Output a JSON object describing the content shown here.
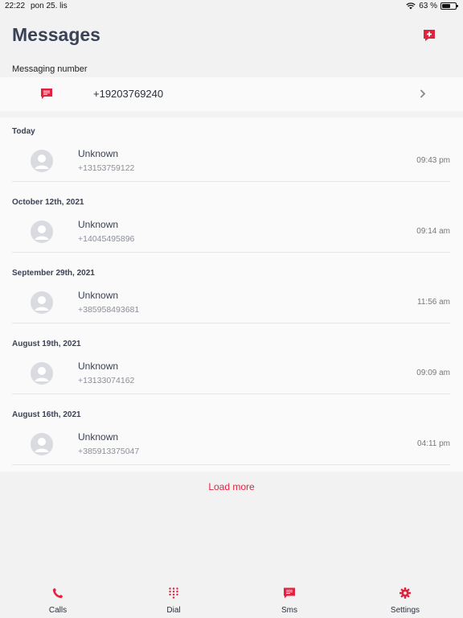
{
  "status_bar": {
    "time": "22:22",
    "date": "pon 25. lis",
    "battery": "63 %",
    "battery_level": 0.63
  },
  "header": {
    "title": "Messages"
  },
  "messaging_number": {
    "label": "Messaging number",
    "value": "+19203769240"
  },
  "groups": [
    {
      "date": "Today",
      "message": {
        "name": "Unknown",
        "number": "+13153759122",
        "time": "09:43 pm"
      }
    },
    {
      "date": "October 12th, 2021",
      "message": {
        "name": "Unknown",
        "number": "+14045495896",
        "time": "09:14 am"
      }
    },
    {
      "date": "September 29th, 2021",
      "message": {
        "name": "Unknown",
        "number": "+385958493681",
        "time": "11:56 am"
      }
    },
    {
      "date": "August 19th, 2021",
      "message": {
        "name": "Unknown",
        "number": "+13133074162",
        "time": "09:09 am"
      }
    },
    {
      "date": "August 16th, 2021",
      "message": {
        "name": "Unknown",
        "number": "+385913375047",
        "time": "04:11 pm"
      }
    }
  ],
  "load_more": "Load more",
  "tabs": [
    {
      "label": "Calls",
      "icon": "phone-icon"
    },
    {
      "label": "Dial",
      "icon": "dialpad-icon"
    },
    {
      "label": "Sms",
      "icon": "sms-icon"
    },
    {
      "label": "Settings",
      "icon": "gear-icon"
    }
  ],
  "colors": {
    "accent": "#e0243f",
    "title": "#3a4257",
    "background": "#f2f2f2"
  }
}
